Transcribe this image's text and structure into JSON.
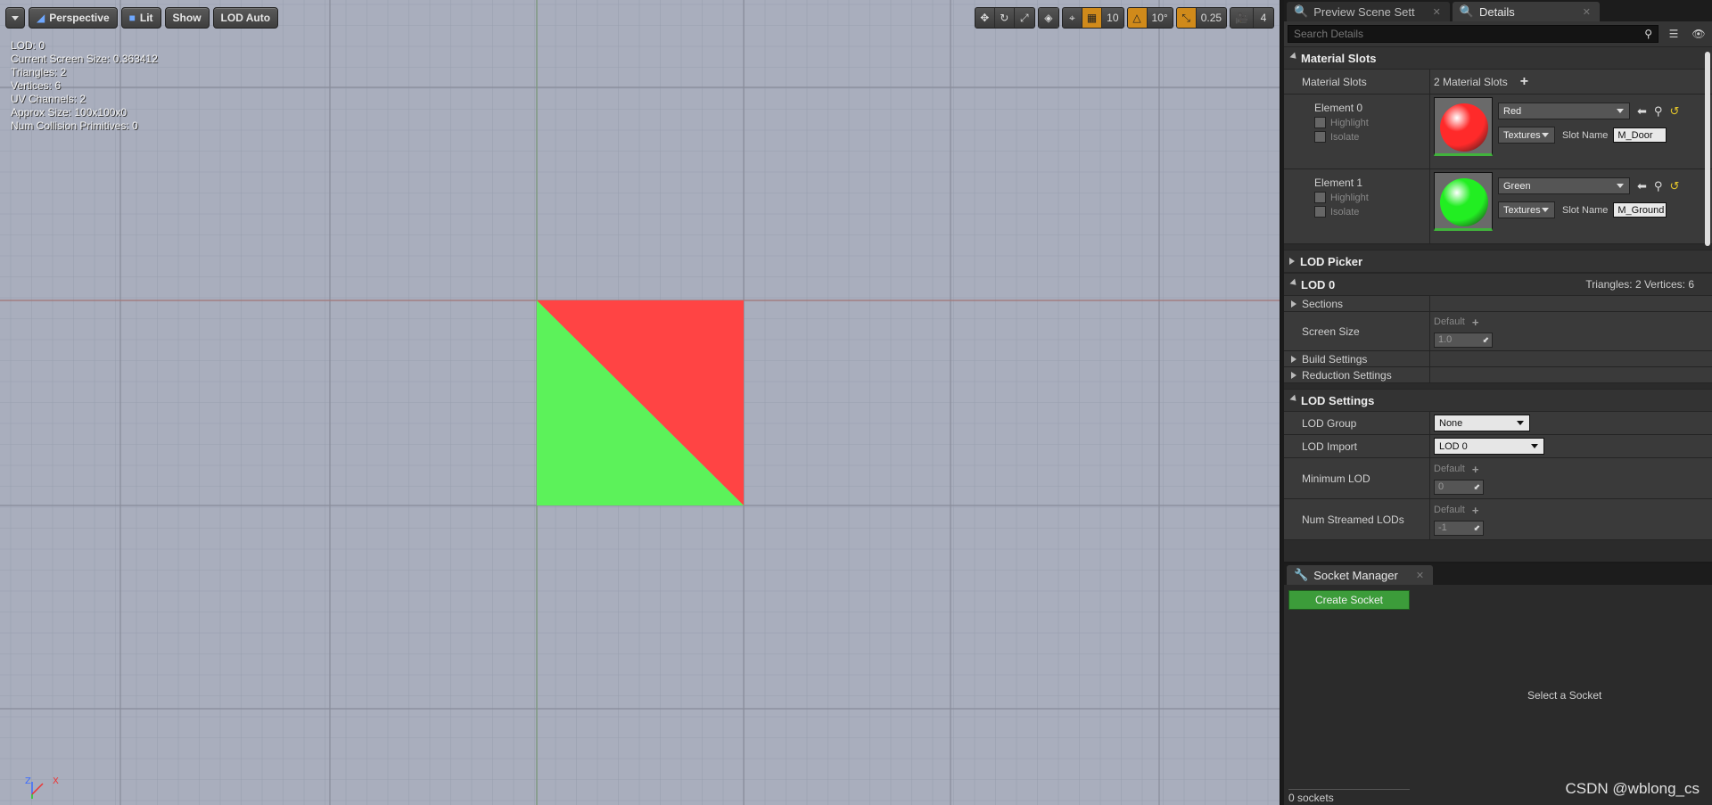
{
  "viewport": {
    "toolbar": {
      "view_mode": "Perspective",
      "lighting": "Lit",
      "show": "Show",
      "lod": "LOD Auto"
    },
    "right_toolbar": {
      "grid_snap": "10",
      "rotation_snap": "10°",
      "scale_snap": "0.25",
      "camera_speed": "4"
    },
    "stats": [
      "LOD:  0",
      "Current Screen Size:  0.363412",
      "Triangles:  2",
      "Vertices:  6",
      "UV Channels:  2",
      "Approx Size: 100x100x0",
      "Num Collision Primitives:  0"
    ],
    "mesh_colors": {
      "red": "#ff4444",
      "green": "#5cf25a"
    },
    "axis_labels": {
      "z": "Z",
      "x": "X",
      "y": "Y"
    }
  },
  "tabs": [
    {
      "label": "Preview Scene Sett",
      "icon": "preview-scene-icon",
      "active": false
    },
    {
      "label": "Details",
      "icon": "details-icon",
      "active": true
    }
  ],
  "search": {
    "placeholder": "Search Details"
  },
  "material_slots": {
    "header": "Material Slots",
    "row_label": "Material Slots",
    "count_text": "2 Material Slots",
    "elements": [
      {
        "name": "Element 0",
        "highlight": "Highlight",
        "isolate": "Isolate",
        "material": "Red",
        "textures": "Textures",
        "slot_name_label": "Slot Name",
        "slot_name": "M_Door",
        "color": "#ff2a2a"
      },
      {
        "name": "Element 1",
        "highlight": "Highlight",
        "isolate": "Isolate",
        "material": "Green",
        "textures": "Textures",
        "slot_name_label": "Slot Name",
        "slot_name": "M_Ground",
        "color": "#22ee22"
      }
    ]
  },
  "lod_picker": {
    "header": "LOD Picker"
  },
  "lod0": {
    "header": "LOD 0",
    "summary": "Triangles: 2   Vertices: 6",
    "sections": "Sections",
    "screen_size_label": "Screen Size",
    "default_label": "Default",
    "screen_size_value": "1.0",
    "build_settings": "Build Settings",
    "reduction_settings": "Reduction Settings"
  },
  "lod_settings": {
    "header": "LOD Settings",
    "lod_group_label": "LOD Group",
    "lod_group_value": "None",
    "lod_import_label": "LOD Import",
    "lod_import_value": "LOD 0",
    "min_lod_label": "Minimum LOD",
    "min_lod_default": "Default",
    "min_lod_value": "0",
    "num_streamed_label": "Num Streamed LODs",
    "num_streamed_default": "Default",
    "num_streamed_value": "-1"
  },
  "socket_manager": {
    "tab": "Socket Manager",
    "create_button": "Create Socket",
    "empty_text": "Select a Socket",
    "footer": "0 sockets"
  },
  "watermark": "CSDN @wblong_cs"
}
